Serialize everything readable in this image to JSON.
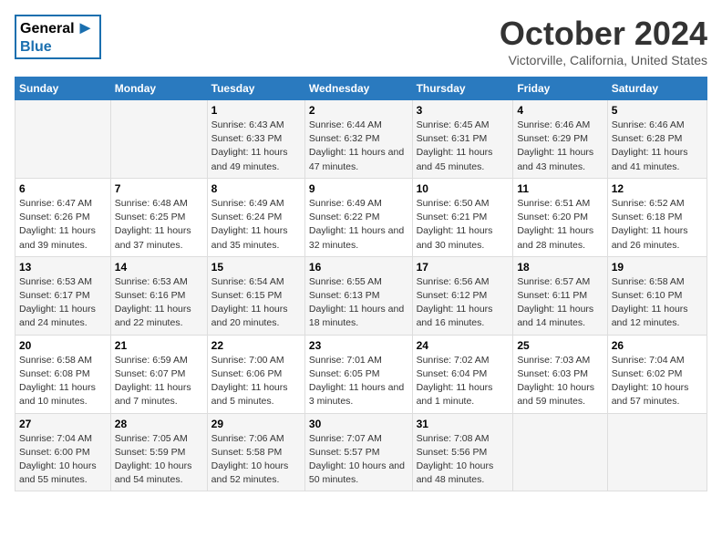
{
  "logo": {
    "general": "General",
    "blue": "Blue",
    "arrow": "▶"
  },
  "title": "October 2024",
  "location": "Victorville, California, United States",
  "headers": [
    "Sunday",
    "Monday",
    "Tuesday",
    "Wednesday",
    "Thursday",
    "Friday",
    "Saturday"
  ],
  "weeks": [
    [
      {
        "day": "",
        "detail": ""
      },
      {
        "day": "",
        "detail": ""
      },
      {
        "day": "1",
        "detail": "Sunrise: 6:43 AM\nSunset: 6:33 PM\nDaylight: 11 hours and 49 minutes."
      },
      {
        "day": "2",
        "detail": "Sunrise: 6:44 AM\nSunset: 6:32 PM\nDaylight: 11 hours and 47 minutes."
      },
      {
        "day": "3",
        "detail": "Sunrise: 6:45 AM\nSunset: 6:31 PM\nDaylight: 11 hours and 45 minutes."
      },
      {
        "day": "4",
        "detail": "Sunrise: 6:46 AM\nSunset: 6:29 PM\nDaylight: 11 hours and 43 minutes."
      },
      {
        "day": "5",
        "detail": "Sunrise: 6:46 AM\nSunset: 6:28 PM\nDaylight: 11 hours and 41 minutes."
      }
    ],
    [
      {
        "day": "6",
        "detail": "Sunrise: 6:47 AM\nSunset: 6:26 PM\nDaylight: 11 hours and 39 minutes."
      },
      {
        "day": "7",
        "detail": "Sunrise: 6:48 AM\nSunset: 6:25 PM\nDaylight: 11 hours and 37 minutes."
      },
      {
        "day": "8",
        "detail": "Sunrise: 6:49 AM\nSunset: 6:24 PM\nDaylight: 11 hours and 35 minutes."
      },
      {
        "day": "9",
        "detail": "Sunrise: 6:49 AM\nSunset: 6:22 PM\nDaylight: 11 hours and 32 minutes."
      },
      {
        "day": "10",
        "detail": "Sunrise: 6:50 AM\nSunset: 6:21 PM\nDaylight: 11 hours and 30 minutes."
      },
      {
        "day": "11",
        "detail": "Sunrise: 6:51 AM\nSunset: 6:20 PM\nDaylight: 11 hours and 28 minutes."
      },
      {
        "day": "12",
        "detail": "Sunrise: 6:52 AM\nSunset: 6:18 PM\nDaylight: 11 hours and 26 minutes."
      }
    ],
    [
      {
        "day": "13",
        "detail": "Sunrise: 6:53 AM\nSunset: 6:17 PM\nDaylight: 11 hours and 24 minutes."
      },
      {
        "day": "14",
        "detail": "Sunrise: 6:53 AM\nSunset: 6:16 PM\nDaylight: 11 hours and 22 minutes."
      },
      {
        "day": "15",
        "detail": "Sunrise: 6:54 AM\nSunset: 6:15 PM\nDaylight: 11 hours and 20 minutes."
      },
      {
        "day": "16",
        "detail": "Sunrise: 6:55 AM\nSunset: 6:13 PM\nDaylight: 11 hours and 18 minutes."
      },
      {
        "day": "17",
        "detail": "Sunrise: 6:56 AM\nSunset: 6:12 PM\nDaylight: 11 hours and 16 minutes."
      },
      {
        "day": "18",
        "detail": "Sunrise: 6:57 AM\nSunset: 6:11 PM\nDaylight: 11 hours and 14 minutes."
      },
      {
        "day": "19",
        "detail": "Sunrise: 6:58 AM\nSunset: 6:10 PM\nDaylight: 11 hours and 12 minutes."
      }
    ],
    [
      {
        "day": "20",
        "detail": "Sunrise: 6:58 AM\nSunset: 6:08 PM\nDaylight: 11 hours and 10 minutes."
      },
      {
        "day": "21",
        "detail": "Sunrise: 6:59 AM\nSunset: 6:07 PM\nDaylight: 11 hours and 7 minutes."
      },
      {
        "day": "22",
        "detail": "Sunrise: 7:00 AM\nSunset: 6:06 PM\nDaylight: 11 hours and 5 minutes."
      },
      {
        "day": "23",
        "detail": "Sunrise: 7:01 AM\nSunset: 6:05 PM\nDaylight: 11 hours and 3 minutes."
      },
      {
        "day": "24",
        "detail": "Sunrise: 7:02 AM\nSunset: 6:04 PM\nDaylight: 11 hours and 1 minute."
      },
      {
        "day": "25",
        "detail": "Sunrise: 7:03 AM\nSunset: 6:03 PM\nDaylight: 10 hours and 59 minutes."
      },
      {
        "day": "26",
        "detail": "Sunrise: 7:04 AM\nSunset: 6:02 PM\nDaylight: 10 hours and 57 minutes."
      }
    ],
    [
      {
        "day": "27",
        "detail": "Sunrise: 7:04 AM\nSunset: 6:00 PM\nDaylight: 10 hours and 55 minutes."
      },
      {
        "day": "28",
        "detail": "Sunrise: 7:05 AM\nSunset: 5:59 PM\nDaylight: 10 hours and 54 minutes."
      },
      {
        "day": "29",
        "detail": "Sunrise: 7:06 AM\nSunset: 5:58 PM\nDaylight: 10 hours and 52 minutes."
      },
      {
        "day": "30",
        "detail": "Sunrise: 7:07 AM\nSunset: 5:57 PM\nDaylight: 10 hours and 50 minutes."
      },
      {
        "day": "31",
        "detail": "Sunrise: 7:08 AM\nSunset: 5:56 PM\nDaylight: 10 hours and 48 minutes."
      },
      {
        "day": "",
        "detail": ""
      },
      {
        "day": "",
        "detail": ""
      }
    ]
  ]
}
